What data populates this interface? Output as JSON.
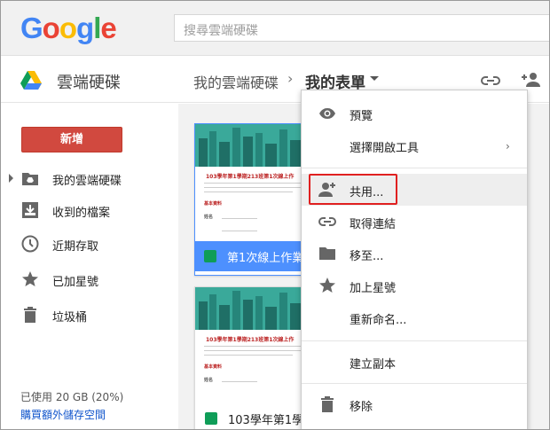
{
  "header": {
    "logo": [
      "G",
      "o",
      "o",
      "g",
      "l",
      "e"
    ],
    "logo_colors": [
      "#4285f4",
      "#ea4335",
      "#fbbc05",
      "#4285f4",
      "#34a853",
      "#ea4335"
    ],
    "search_placeholder": "搜尋雲端硬碟"
  },
  "toolbar": {
    "app_title": "雲端硬碟",
    "breadcrumb_parent": "我的雲端硬碟",
    "breadcrumb_sep": "›",
    "breadcrumb_current": "我的表單"
  },
  "sidebar": {
    "new_button": "新增",
    "items": [
      {
        "label": "我的雲端硬碟",
        "icon": "drive-folder-icon"
      },
      {
        "label": "收到的檔案",
        "icon": "inbox-download-icon"
      },
      {
        "label": "近期存取",
        "icon": "clock-icon"
      },
      {
        "label": "已加星號",
        "icon": "star-icon"
      },
      {
        "label": "垃圾桶",
        "icon": "trash-icon"
      }
    ],
    "storage_used": "已使用 20 GB (20%)",
    "buy_storage": "購買額外儲存空間"
  },
  "files": [
    {
      "name": "第1次線上作業",
      "thumb_title": "103學年第1學期213班第1次線上作",
      "selected": true
    },
    {
      "name": "103學年第1學",
      "thumb_title": "103學年第1學期213班第1次線上作",
      "selected": false
    }
  ],
  "thumb_labels": {
    "section": "基本資料",
    "field": "姓名"
  },
  "menu": {
    "items": [
      {
        "label": "預覽",
        "icon": "eye-icon"
      },
      {
        "label": "選擇開啟工具",
        "icon": "",
        "submenu": "›"
      },
      {
        "label": "共用...",
        "icon": "person-add-icon"
      },
      {
        "label": "取得連結",
        "icon": "link-icon"
      },
      {
        "label": "移至...",
        "icon": "folder-icon"
      },
      {
        "label": "加上星號",
        "icon": "star-icon"
      },
      {
        "label": "重新命名...",
        "icon": ""
      },
      {
        "label": "建立副本",
        "icon": ""
      },
      {
        "label": "移除",
        "icon": "trash-icon"
      }
    ]
  },
  "colors": {
    "accent": "#4d90fe",
    "new_button": "#d1493f",
    "highlight_box": "#e02020",
    "forms_green": "#0f9d58"
  }
}
